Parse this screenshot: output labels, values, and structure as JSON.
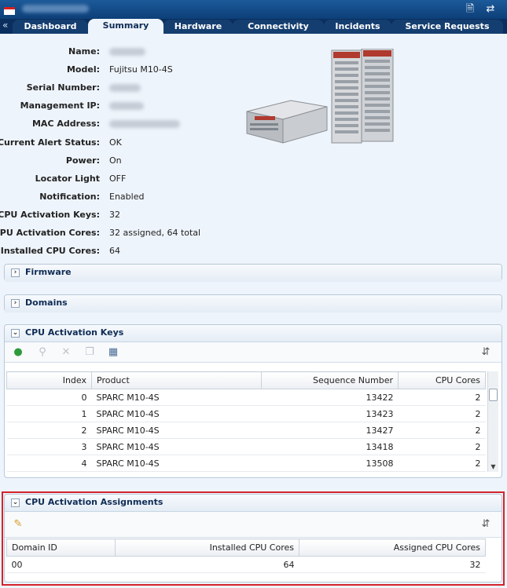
{
  "tabs": [
    {
      "label": "Dashboard",
      "active": false
    },
    {
      "label": "Summary",
      "active": true
    },
    {
      "label": "Hardware",
      "active": false
    },
    {
      "label": "Connectivity",
      "active": false
    },
    {
      "label": "Incidents",
      "active": false
    },
    {
      "label": "Service Requests",
      "active": false
    }
  ],
  "summary": {
    "name_label": "Name:",
    "model_label": "Model:",
    "model_value": "Fujitsu M10-4S",
    "serial_label": "Serial Number:",
    "mgmt_ip_label": "Management IP:",
    "mac_label": "MAC Address:",
    "alert_label": "Current Alert Status:",
    "alert_value": "OK",
    "power_label": "Power:",
    "power_value": "On",
    "locator_label": "Locator Light",
    "locator_value": "OFF",
    "notification_label": "Notification:",
    "notification_value": "Enabled",
    "cpu_keys_label": "CPU Activation Keys:",
    "cpu_keys_value": "32",
    "cpu_cores_label": "CPU Activation Cores:",
    "cpu_cores_value": "32 assigned, 64 total",
    "installed_label": "Installed CPU Cores:",
    "installed_value": "64"
  },
  "firmware": {
    "title": "Firmware"
  },
  "domains": {
    "title": "Domains"
  },
  "cpu_keys": {
    "title": "CPU Activation Keys",
    "columns": [
      "Index",
      "Product",
      "Sequence Number",
      "CPU Cores"
    ],
    "rows": [
      {
        "index": "0",
        "product": "SPARC M10-4S",
        "seq": "13422",
        "cores": "2"
      },
      {
        "index": "1",
        "product": "SPARC M10-4S",
        "seq": "13423",
        "cores": "2"
      },
      {
        "index": "2",
        "product": "SPARC M10-4S",
        "seq": "13427",
        "cores": "2"
      },
      {
        "index": "3",
        "product": "SPARC M10-4S",
        "seq": "13418",
        "cores": "2"
      },
      {
        "index": "4",
        "product": "SPARC M10-4S",
        "seq": "13508",
        "cores": "2"
      }
    ]
  },
  "cpu_assign": {
    "title": "CPU Activation Assignments",
    "columns": [
      "Domain ID",
      "Installed CPU Cores",
      "Assigned CPU Cores"
    ],
    "rows": [
      {
        "domain": "00",
        "installed": "64",
        "assigned": "32"
      }
    ]
  }
}
